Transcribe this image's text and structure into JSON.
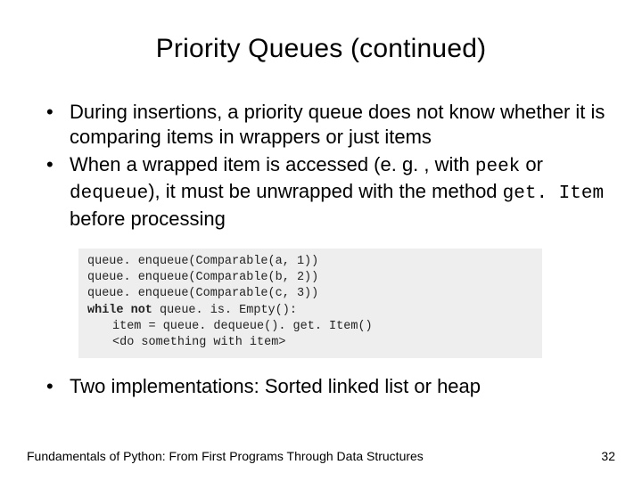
{
  "slide": {
    "title": "Priority Queues (continued)",
    "bullets": {
      "b1_pre": "During insertions, a priority queue does not know whether it is comparing items in wrappers or just items",
      "b2_p1": "When a wrapped item is accessed (e. g. , with ",
      "b2_code1": "peek",
      "b2_p2": " or ",
      "b2_code2": "dequeue",
      "b2_p3": "), it must be unwrapped with the method ",
      "b2_code3": "get. Item",
      "b2_p4": " before processing",
      "b3": "Two implementations: Sorted linked list or heap"
    },
    "code": {
      "l1": "queue. enqueue(Comparable(a, 1))",
      "l2": "queue. enqueue(Comparable(b, 2))",
      "l3": "queue. enqueue(Comparable(c, 3))",
      "l4a": "while not",
      "l4b": " queue. is. Empty():",
      "l5": "item = queue. dequeue(). get. Item()",
      "l6": "<do something with item>"
    },
    "footer": {
      "text": "Fundamentals of Python: From First Programs Through Data Structures",
      "page": "32"
    }
  }
}
